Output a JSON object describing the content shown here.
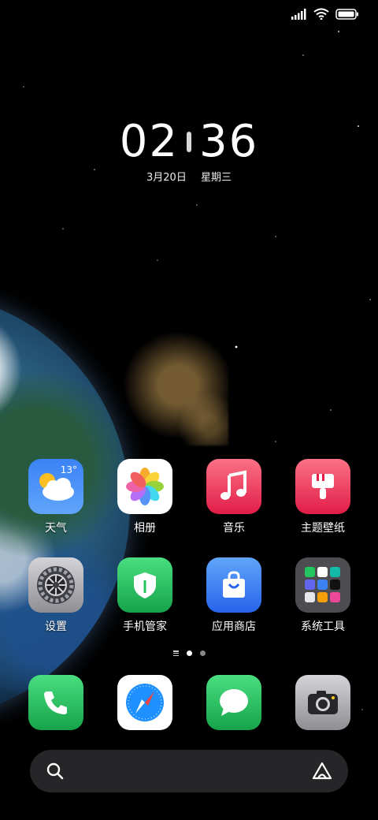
{
  "clock": {
    "hours": "02",
    "minutes": "36",
    "date": "3月20日",
    "weekday": "星期三"
  },
  "status_bar": {
    "signal_icon": "signal-icon",
    "wifi_icon": "wifi-icon",
    "battery_icon": "battery-icon"
  },
  "apps": {
    "weather": {
      "label": "天气",
      "temp": "13°"
    },
    "photos": {
      "label": "相册"
    },
    "music": {
      "label": "音乐"
    },
    "themes": {
      "label": "主题壁纸"
    },
    "settings": {
      "label": "设置"
    },
    "security": {
      "label": "手机管家"
    },
    "app_store": {
      "label": "应用商店"
    },
    "system_tools": {
      "label": "系统工具"
    }
  },
  "dock": {
    "phone": "phone-icon",
    "browser": "compass-icon",
    "messages": "message-icon",
    "camera": "camera-icon"
  },
  "search": {
    "search_icon": "search-icon",
    "assistant_icon": "assistant-icon"
  },
  "colors": {
    "music": "#f43f5e",
    "themes": "#f43f5e",
    "security": "#22c55e",
    "app_store": "#3b82f6",
    "phone": "#22c55e",
    "messages": "#22c55e"
  }
}
